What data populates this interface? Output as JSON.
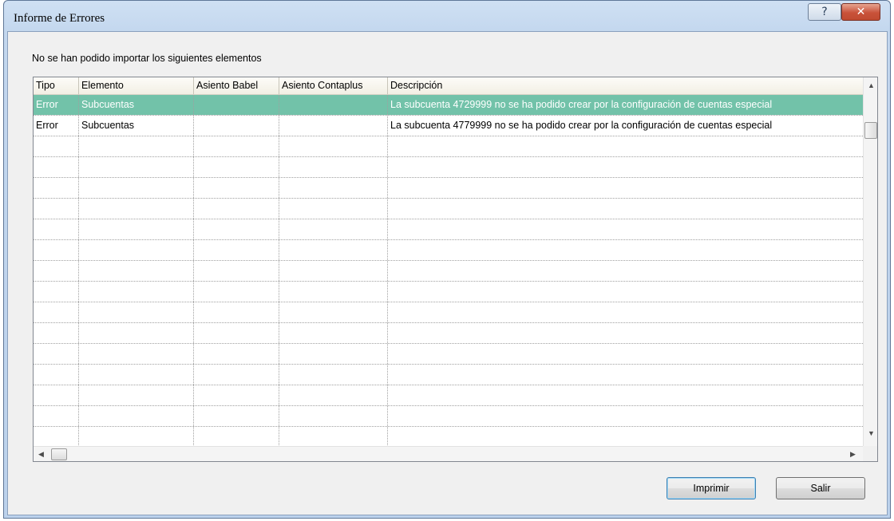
{
  "window": {
    "title": "Informe de Errores",
    "help_glyph": "?",
    "close_glyph": "✕"
  },
  "message": "No se han podido importar los siguientes elementos",
  "table": {
    "columns": [
      "Tipo",
      "Elemento",
      "Asiento Babel",
      "Asiento Contaplus",
      "Descripción"
    ],
    "rows": [
      [
        "Error",
        "Subcuentas",
        "",
        "",
        "La subcuenta 4729999 no se ha podido crear por la configuración de cuentas especial"
      ],
      [
        "Error",
        "Subcuentas",
        "",
        "",
        "La subcuenta 4779999 no se ha podido crear por la configuración de cuentas especial"
      ]
    ],
    "selected_row": 0,
    "selection_color": "#72c2a9"
  },
  "buttons": {
    "print": "Imprimir",
    "exit": "Salir"
  },
  "scroll": {
    "up": "▲",
    "down": "▼",
    "left": "◀",
    "right": "▶"
  },
  "icons": [
    "help-icon",
    "close-icon",
    "scroll-arrow-icons"
  ]
}
